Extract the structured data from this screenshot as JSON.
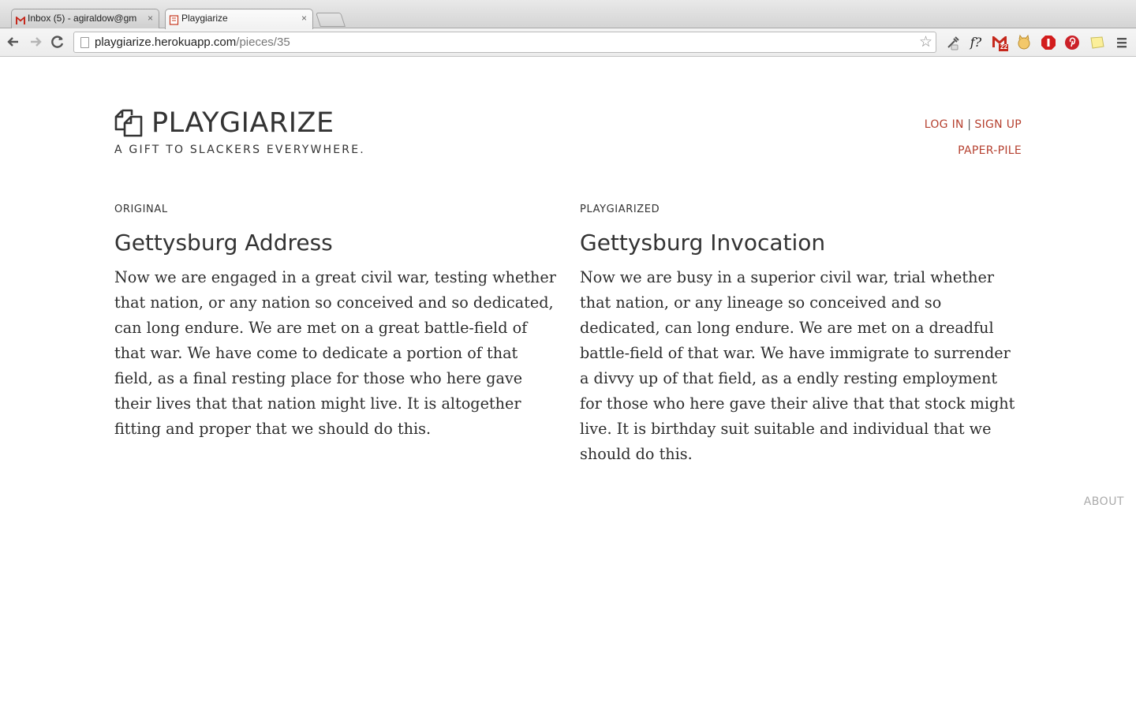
{
  "browser": {
    "tabs": [
      {
        "title": "Inbox (5) - agiraldow@gm",
        "active": false,
        "close": "×"
      },
      {
        "title": "Playgiarize",
        "active": true,
        "close": "×"
      }
    ],
    "url_host": "playgiarize.herokuapp.com",
    "url_path": "/pieces/35",
    "extensions": [
      "eyedropper-icon",
      "fonts-icon",
      "gmail-checker-icon",
      "cat-icon",
      "adblock-icon",
      "pinterest-icon",
      "notes-icon",
      "menu-icon"
    ],
    "font_ext_label": "f?",
    "gmail_badge": "22"
  },
  "header": {
    "brand": "PLAYGIARIZE",
    "tagline": "A GIFT TO SLACKERS EVERYWHERE.",
    "login": "LOG IN",
    "separator": "|",
    "signup": "SIGN UP",
    "paper_pile": "PAPER-PILE"
  },
  "original": {
    "label": "ORIGINAL",
    "title": "Gettysburg Address",
    "body": "Now we are engaged in a great civil war, testing whether that nation, or any nation so conceived and so dedicated, can long endure. We are met on a great battle-field of that war. We have come to dedicate a portion of that field, as a final resting place for those who here gave their lives that that nation might live. It is altogether fitting and proper that we should do this."
  },
  "playgiarized": {
    "label": "PLAYGIARIZED",
    "title": "Gettysburg Invocation",
    "body": "Now we are busy in a superior civil war, trial whether that nation, or any lineage so conceived and so dedicated, can long endure. We are met on a dreadful battle-field of that war. We have immigrate to surrender a divvy up of that field, as a endly resting employment for those who here gave their alive that that stock might live. It is birthday suit suitable and individual that we should do this."
  },
  "footer": {
    "about": "ABOUT"
  },
  "colors": {
    "link_red": "#b5402f",
    "text": "#333333",
    "muted": "#aaaaaa"
  }
}
